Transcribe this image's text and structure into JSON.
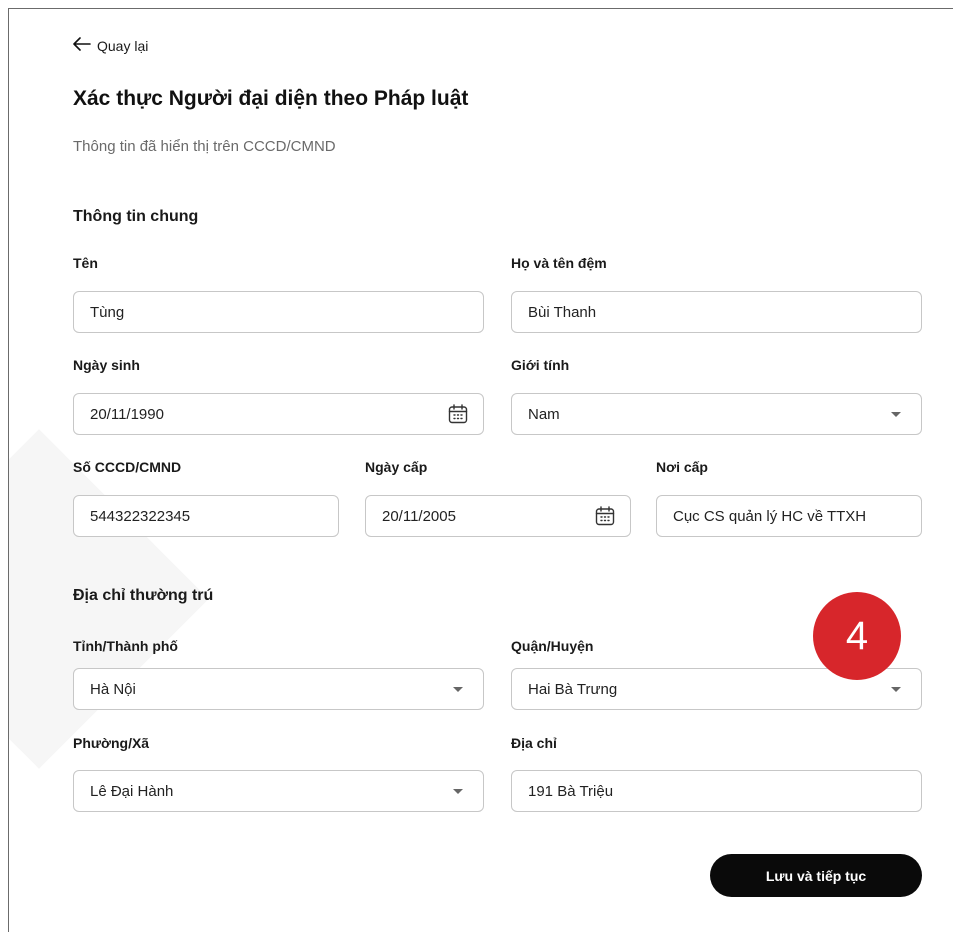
{
  "nav": {
    "back_label": "Quay lại"
  },
  "header": {
    "title": "Xác thực Người đại diện theo Pháp luật",
    "subtitle": "Thông tin đã hiển thị trên CCCD/CMND"
  },
  "general": {
    "section_title": "Thông tin chung",
    "first_name": {
      "label": "Tên",
      "value": "Tùng"
    },
    "last_name": {
      "label": "Họ và tên đệm",
      "value": "Bùi Thanh"
    },
    "dob": {
      "label": "Ngày sinh",
      "value": "20/11/1990"
    },
    "gender": {
      "label": "Giới tính",
      "value": "Nam"
    },
    "id_number": {
      "label": "Số CCCD/CMND",
      "value": "544322322345"
    },
    "issue_date": {
      "label": "Ngày cấp",
      "value": "20/11/2005"
    },
    "issue_place": {
      "label": "Nơi cấp",
      "value": "Cục CS quản lý HC về TTXH"
    }
  },
  "address": {
    "section_title": "Địa chỉ thường trú",
    "province": {
      "label": "Tỉnh/Thành phố",
      "value": "Hà Nội"
    },
    "district": {
      "label": "Quận/Huyện",
      "value": "Hai Bà Trưng"
    },
    "ward": {
      "label": "Phường/Xã",
      "value": "Lê Đại Hành"
    },
    "street": {
      "label": "Địa chỉ",
      "value": "191 Bà Triệu"
    }
  },
  "annotation": {
    "step": "4",
    "color": "#d7262b"
  },
  "actions": {
    "submit_label": "Lưu và tiếp tục"
  }
}
